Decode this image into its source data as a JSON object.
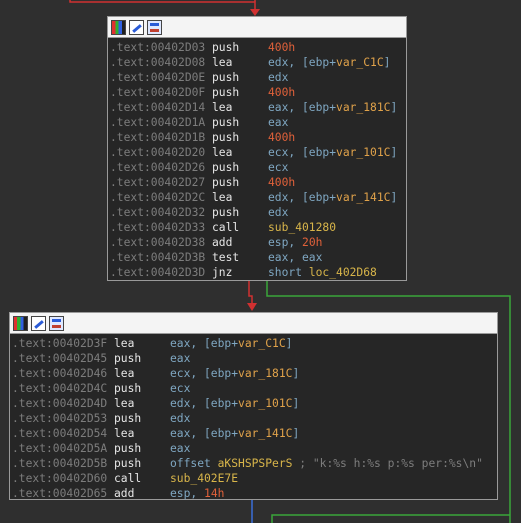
{
  "colors": {
    "background": "#2f2f2f",
    "node_bg": "#262626",
    "edge_true": "#3aa63a",
    "edge_false": "#d03030",
    "edge_uncond": "#3a6fd8"
  },
  "nodes": [
    {
      "header_icons": [
        "color-icon",
        "rename-icon",
        "graph-icon"
      ],
      "lines": [
        {
          "addr": ".text:00402D03",
          "mn": "push",
          "op": [
            {
              "t": "400h",
              "c": "imm"
            }
          ]
        },
        {
          "addr": ".text:00402D08",
          "mn": "lea",
          "op": [
            {
              "t": "edx, [ebp+"
            },
            {
              "t": "var_C1C",
              "c": "var"
            },
            {
              "t": "]"
            }
          ]
        },
        {
          "addr": ".text:00402D0E",
          "mn": "push",
          "op": [
            {
              "t": "edx"
            }
          ]
        },
        {
          "addr": ".text:00402D0F",
          "mn": "push",
          "op": [
            {
              "t": "400h",
              "c": "imm"
            }
          ]
        },
        {
          "addr": ".text:00402D14",
          "mn": "lea",
          "op": [
            {
              "t": "eax, [ebp+"
            },
            {
              "t": "var_181C",
              "c": "var"
            },
            {
              "t": "]"
            }
          ]
        },
        {
          "addr": ".text:00402D1A",
          "mn": "push",
          "op": [
            {
              "t": "eax"
            }
          ]
        },
        {
          "addr": ".text:00402D1B",
          "mn": "push",
          "op": [
            {
              "t": "400h",
              "c": "imm"
            }
          ]
        },
        {
          "addr": ".text:00402D20",
          "mn": "lea",
          "op": [
            {
              "t": "ecx, [ebp+"
            },
            {
              "t": "var_101C",
              "c": "var"
            },
            {
              "t": "]"
            }
          ]
        },
        {
          "addr": ".text:00402D26",
          "mn": "push",
          "op": [
            {
              "t": "ecx"
            }
          ]
        },
        {
          "addr": ".text:00402D27",
          "mn": "push",
          "op": [
            {
              "t": "400h",
              "c": "imm"
            }
          ]
        },
        {
          "addr": ".text:00402D2C",
          "mn": "lea",
          "op": [
            {
              "t": "edx, [ebp+"
            },
            {
              "t": "var_141C",
              "c": "var"
            },
            {
              "t": "]"
            }
          ]
        },
        {
          "addr": ".text:00402D32",
          "mn": "push",
          "op": [
            {
              "t": "edx"
            }
          ]
        },
        {
          "addr": ".text:00402D33",
          "mn": "call",
          "op": [
            {
              "t": "sub_401280",
              "c": "sym"
            }
          ]
        },
        {
          "addr": ".text:00402D38",
          "mn": "add",
          "op": [
            {
              "t": "esp, "
            },
            {
              "t": "20h",
              "c": "imm"
            }
          ]
        },
        {
          "addr": ".text:00402D3B",
          "mn": "test",
          "op": [
            {
              "t": "eax, eax"
            }
          ]
        },
        {
          "addr": ".text:00402D3D",
          "mn": "jnz",
          "op": [
            {
              "t": "short "
            },
            {
              "t": "loc_402D68",
              "c": "sym"
            }
          ]
        }
      ]
    },
    {
      "header_icons": [
        "color-icon",
        "rename-icon",
        "graph-icon"
      ],
      "lines": [
        {
          "addr": ".text:00402D3F",
          "mn": "lea",
          "op": [
            {
              "t": "eax, [ebp+"
            },
            {
              "t": "var_C1C",
              "c": "var"
            },
            {
              "t": "]"
            }
          ]
        },
        {
          "addr": ".text:00402D45",
          "mn": "push",
          "op": [
            {
              "t": "eax"
            }
          ]
        },
        {
          "addr": ".text:00402D46",
          "mn": "lea",
          "op": [
            {
              "t": "ecx, [ebp+"
            },
            {
              "t": "var_181C",
              "c": "var"
            },
            {
              "t": "]"
            }
          ]
        },
        {
          "addr": ".text:00402D4C",
          "mn": "push",
          "op": [
            {
              "t": "ecx"
            }
          ]
        },
        {
          "addr": ".text:00402D4D",
          "mn": "lea",
          "op": [
            {
              "t": "edx, [ebp+"
            },
            {
              "t": "var_101C",
              "c": "var"
            },
            {
              "t": "]"
            }
          ]
        },
        {
          "addr": ".text:00402D53",
          "mn": "push",
          "op": [
            {
              "t": "edx"
            }
          ]
        },
        {
          "addr": ".text:00402D54",
          "mn": "lea",
          "op": [
            {
              "t": "eax, [ebp+"
            },
            {
              "t": "var_141C",
              "c": "var"
            },
            {
              "t": "]"
            }
          ]
        },
        {
          "addr": ".text:00402D5A",
          "mn": "push",
          "op": [
            {
              "t": "eax"
            }
          ]
        },
        {
          "addr": ".text:00402D5B",
          "mn": "push",
          "op": [
            {
              "t": "offset "
            },
            {
              "t": "aKSHSPSPerS",
              "c": "sym"
            },
            {
              "t": " ; \"k:%s h:%s p:%s per:%s\\n\"",
              "c": "cmt"
            }
          ]
        },
        {
          "addr": ".text:00402D60",
          "mn": "call",
          "op": [
            {
              "t": "sub_402E7E",
              "c": "sym"
            }
          ]
        },
        {
          "addr": ".text:00402D65",
          "mn": "add",
          "op": [
            {
              "t": "esp, "
            },
            {
              "t": "14h",
              "c": "imm"
            }
          ]
        }
      ]
    }
  ]
}
